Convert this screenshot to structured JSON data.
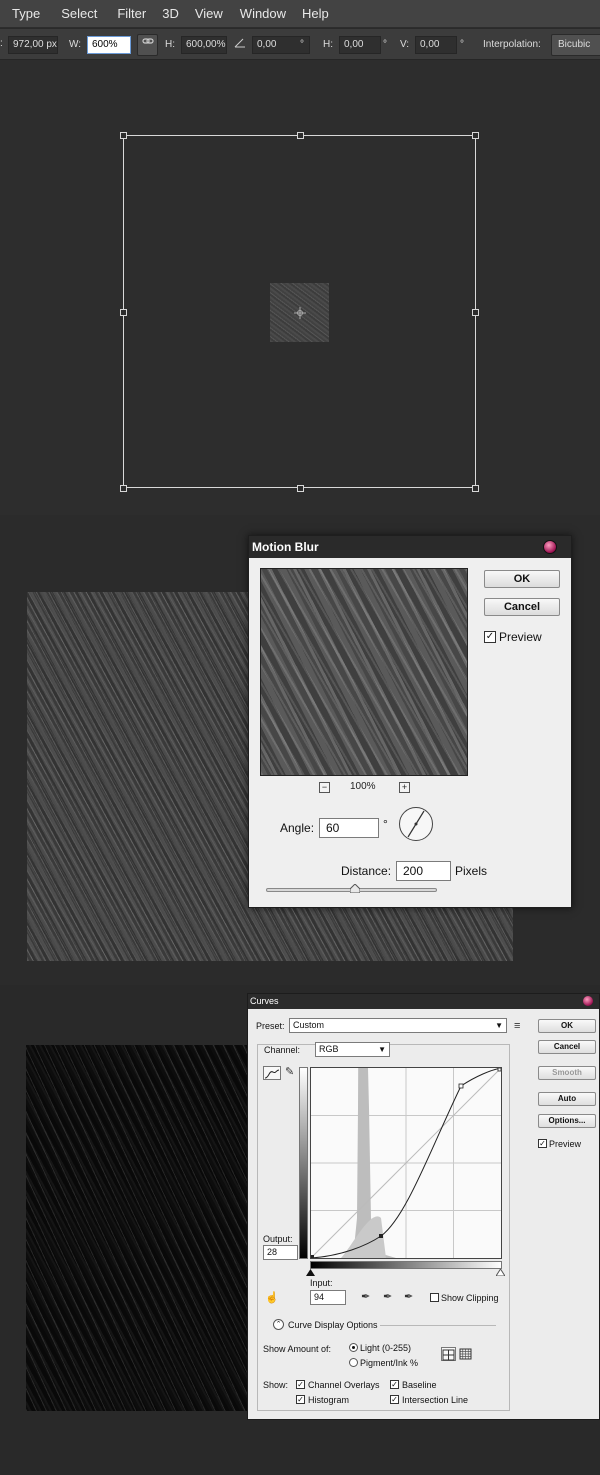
{
  "menu": [
    "Type",
    "Select",
    "Filter",
    "3D",
    "View",
    "Window",
    "Help"
  ],
  "options": {
    "x_value": "972,00 px",
    "w_label": "W:",
    "w_value": "600%",
    "h_label": "H:",
    "h_value": "600,00%",
    "angle_value": "0,00",
    "angle_unit": "°",
    "hskew_label": "H:",
    "hskew_value": "0,00",
    "vskew_label": "V:",
    "vskew_value": "0,00",
    "interp_label": "Interpolation:",
    "interp_value": "Bicubic"
  },
  "motion_blur": {
    "title": "Motion Blur",
    "ok": "OK",
    "cancel": "Cancel",
    "preview_label": "Preview",
    "preview_checked": true,
    "zoom": "100%",
    "zoom_out": "−",
    "zoom_in": "+",
    "angle_label": "Angle:",
    "angle_value": "60",
    "angle_unit": "°",
    "distance_label": "Distance:",
    "distance_value": "200",
    "distance_unit": "Pixels"
  },
  "curves": {
    "title": "Curves",
    "preset_label": "Preset:",
    "preset_value": "Custom",
    "channel_label": "Channel:",
    "channel_value": "RGB",
    "output_label": "Output:",
    "output_value": "28",
    "input_label": "Input:",
    "input_value": "94",
    "ok": "OK",
    "cancel": "Cancel",
    "smooth": "Smooth",
    "auto": "Auto",
    "options": "Options...",
    "preview_label": "Preview",
    "show_clipping": "Show Clipping",
    "display_options": "Curve Display Options",
    "show_amount_label": "Show Amount of:",
    "light_label": "Light  (0-255)",
    "pigment_label": "Pigment/Ink %",
    "show_label": "Show:",
    "channel_overlays": "Channel Overlays",
    "baseline": "Baseline",
    "histogram": "Histogram",
    "intersection_line": "Intersection Line"
  }
}
